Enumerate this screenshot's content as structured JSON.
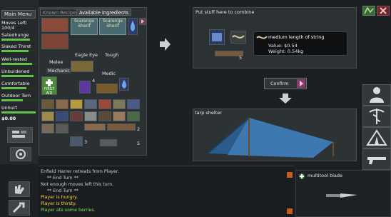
{
  "menu": {
    "main_menu": "Main Menu"
  },
  "stats": {
    "moves_left": "Moves Left:",
    "moves_value": "100/4",
    "satedhunger": "Satedhunge",
    "slaked_thirst": "Slaked Thirst",
    "well_rested": "Well-rested",
    "unburdened": "Unburdened",
    "comfortable": "Comfortable",
    "outdoor_temp": "Outdoor Tem",
    "unhurt": "Unhurt",
    "money": "$0.00"
  },
  "crafting": {
    "tab_known_recipes": "Known Recipes",
    "tab_available_ingredients": "Available Ingredients",
    "recipe_card_1": "Scarenge Sherif",
    "recipe_card_2": "Scarenge Sherif",
    "eagle_eye": "Eagle Eye",
    "tough": "Tough",
    "melee": "Melee",
    "mechanic": "Mechanic",
    "medic": "Medic",
    "first_aid": "FIRST AID",
    "count_4": "4",
    "count_2": "2",
    "count_3": "3",
    "count_5": "5"
  },
  "combine": {
    "instruction": "Put stuff here to combine",
    "tooltip_title": "medium length of string",
    "tooltip_value": "Value: $0.54",
    "tooltip_weight": "Weight: 0.54kg",
    "item_count": "5",
    "confirm_label": "Confirm"
  },
  "shelter": {
    "label": "tarp shelter"
  },
  "log": {
    "lines": [
      {
        "text": "Enfield Harrer retreats from Player.",
        "color": "#cfcfcf"
      },
      {
        "text": "** End Turn **",
        "color": "#cfcfcf"
      },
      {
        "text": "Not enough moves left this turn.",
        "color": "#cfcfcf"
      },
      {
        "text": "** End Turn **",
        "color": "#cfcfcf"
      },
      {
        "text": "Player is hungry.",
        "color": "#ffd23a"
      },
      {
        "text": "Player is thirsty.",
        "color": "#ffd23a"
      },
      {
        "text": "Player ate some berries.",
        "color": "#7be05a"
      }
    ]
  },
  "tool": {
    "name": "multitool blade"
  },
  "colors": {
    "accent_green": "#62c24a",
    "warning_yellow": "#ffd23a",
    "panel": "#2c3133"
  }
}
